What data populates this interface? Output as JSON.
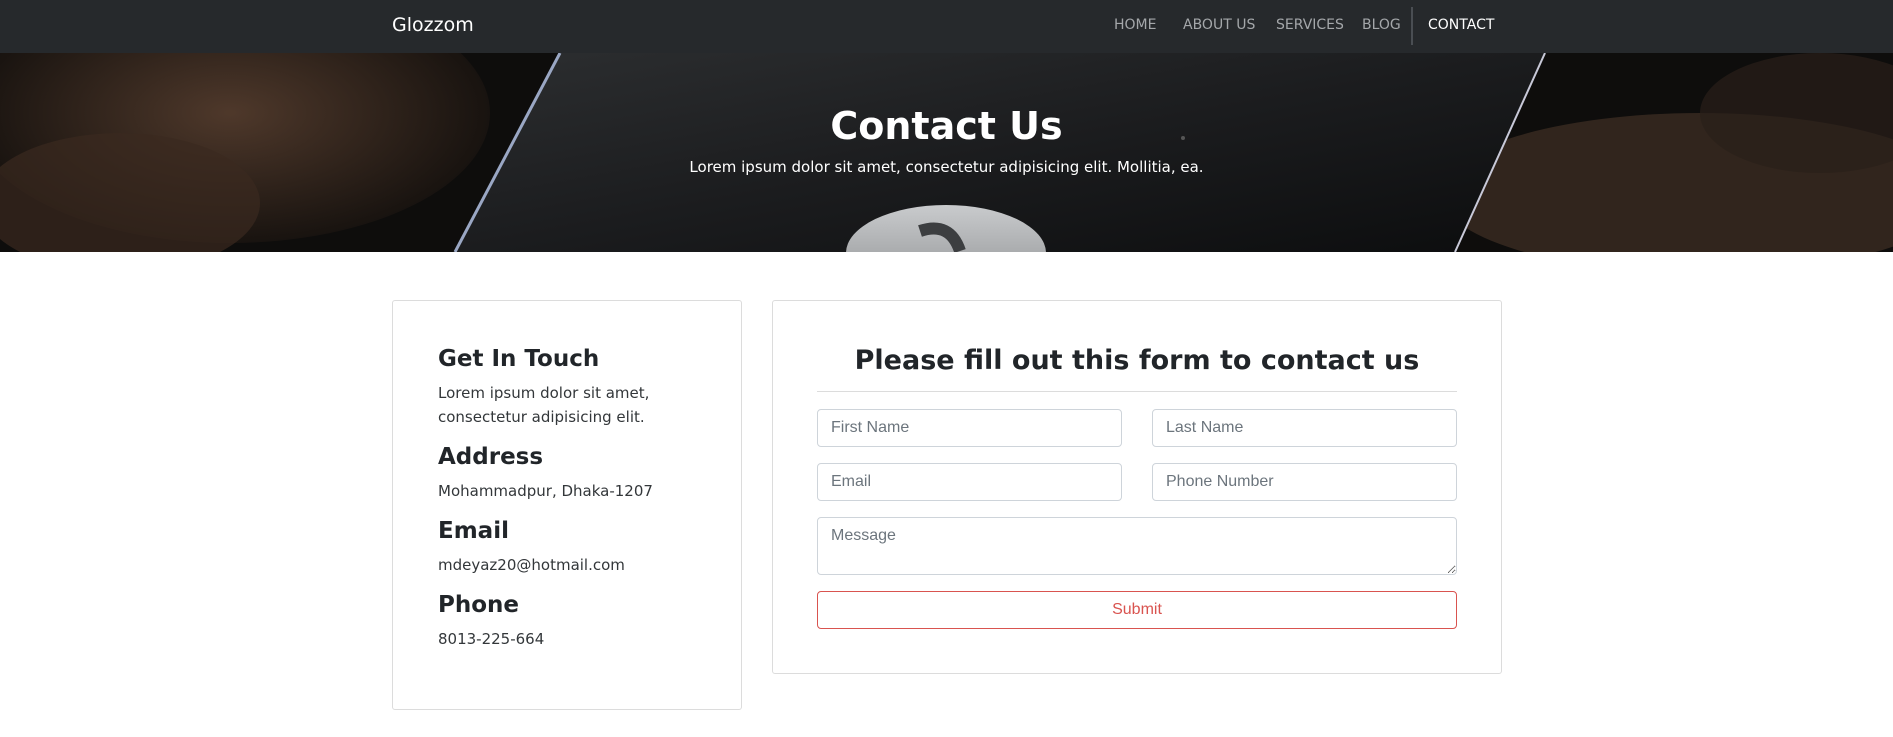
{
  "navbar": {
    "brand": "Glozzom",
    "links": [
      {
        "label": "HOME"
      },
      {
        "label": "ABOUT US"
      },
      {
        "label": "SERVICES"
      },
      {
        "label": "BLOG"
      },
      {
        "label": "CONTACT",
        "active": true
      }
    ]
  },
  "hero": {
    "title": "Contact Us",
    "subtitle": "Lorem ipsum dolor sit amet, consectetur adipisicing elit. Mollitia, ea."
  },
  "info": {
    "touch_heading": "Get In Touch",
    "touch_text": "Lorem ipsum dolor sit amet, consectetur adipisicing elit.",
    "address_heading": "Address",
    "address_text": "Mohammadpur, Dhaka-1207",
    "email_heading": "Email",
    "email_text": "mdeyaz20@hotmail.com",
    "phone_heading": "Phone",
    "phone_text": "8013-225-664"
  },
  "form": {
    "title": "Please fill out this form to contact us",
    "first_name_placeholder": "First Name",
    "last_name_placeholder": "Last Name",
    "email_placeholder": "Email",
    "phone_placeholder": "Phone Number",
    "message_placeholder": "Message",
    "submit_label": "Submit"
  },
  "colors": {
    "navbar_bg": "#26292c",
    "nav_link": "#a4a7aa",
    "nav_active": "#ffffff",
    "submit_accent": "#d9534f"
  }
}
